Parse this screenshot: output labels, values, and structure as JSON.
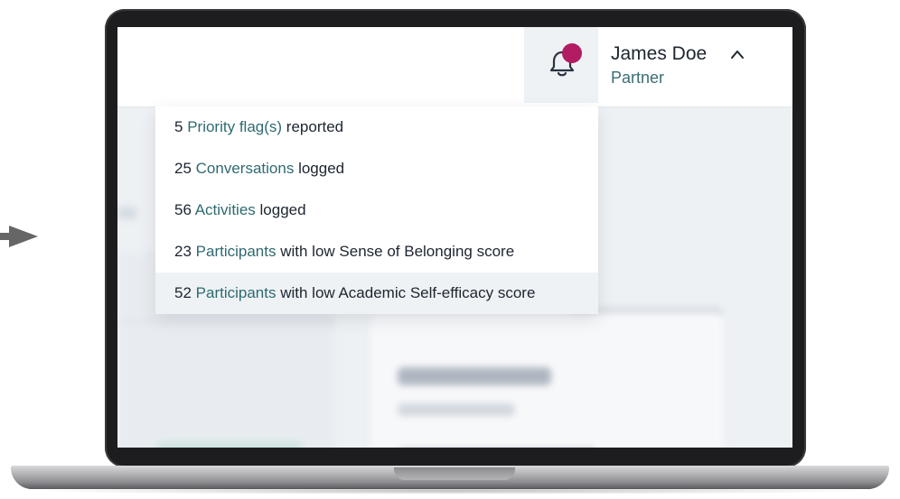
{
  "header": {
    "user_name": "James Doe",
    "user_role": "Partner"
  },
  "notifications": [
    {
      "count": "5",
      "link": "Priority flag(s)",
      "suffix": "reported"
    },
    {
      "count": "25",
      "link": "Conversations",
      "suffix": "logged"
    },
    {
      "count": "56",
      "link": "Activities",
      "suffix": "logged"
    },
    {
      "count": "23",
      "link": "Participants",
      "suffix": "with low Sense of Belonging score"
    },
    {
      "count": "52",
      "link": "Participants",
      "suffix": "with low Academic Self-efficacy score"
    }
  ],
  "colors": {
    "accent_text": "#2f6a70",
    "notification_dot": "#b21c63",
    "laptop_bezel": "#1d1d1f"
  },
  "icons": [
    "arrow-pointer-icon",
    "bell-icon",
    "caret-up-icon"
  ]
}
